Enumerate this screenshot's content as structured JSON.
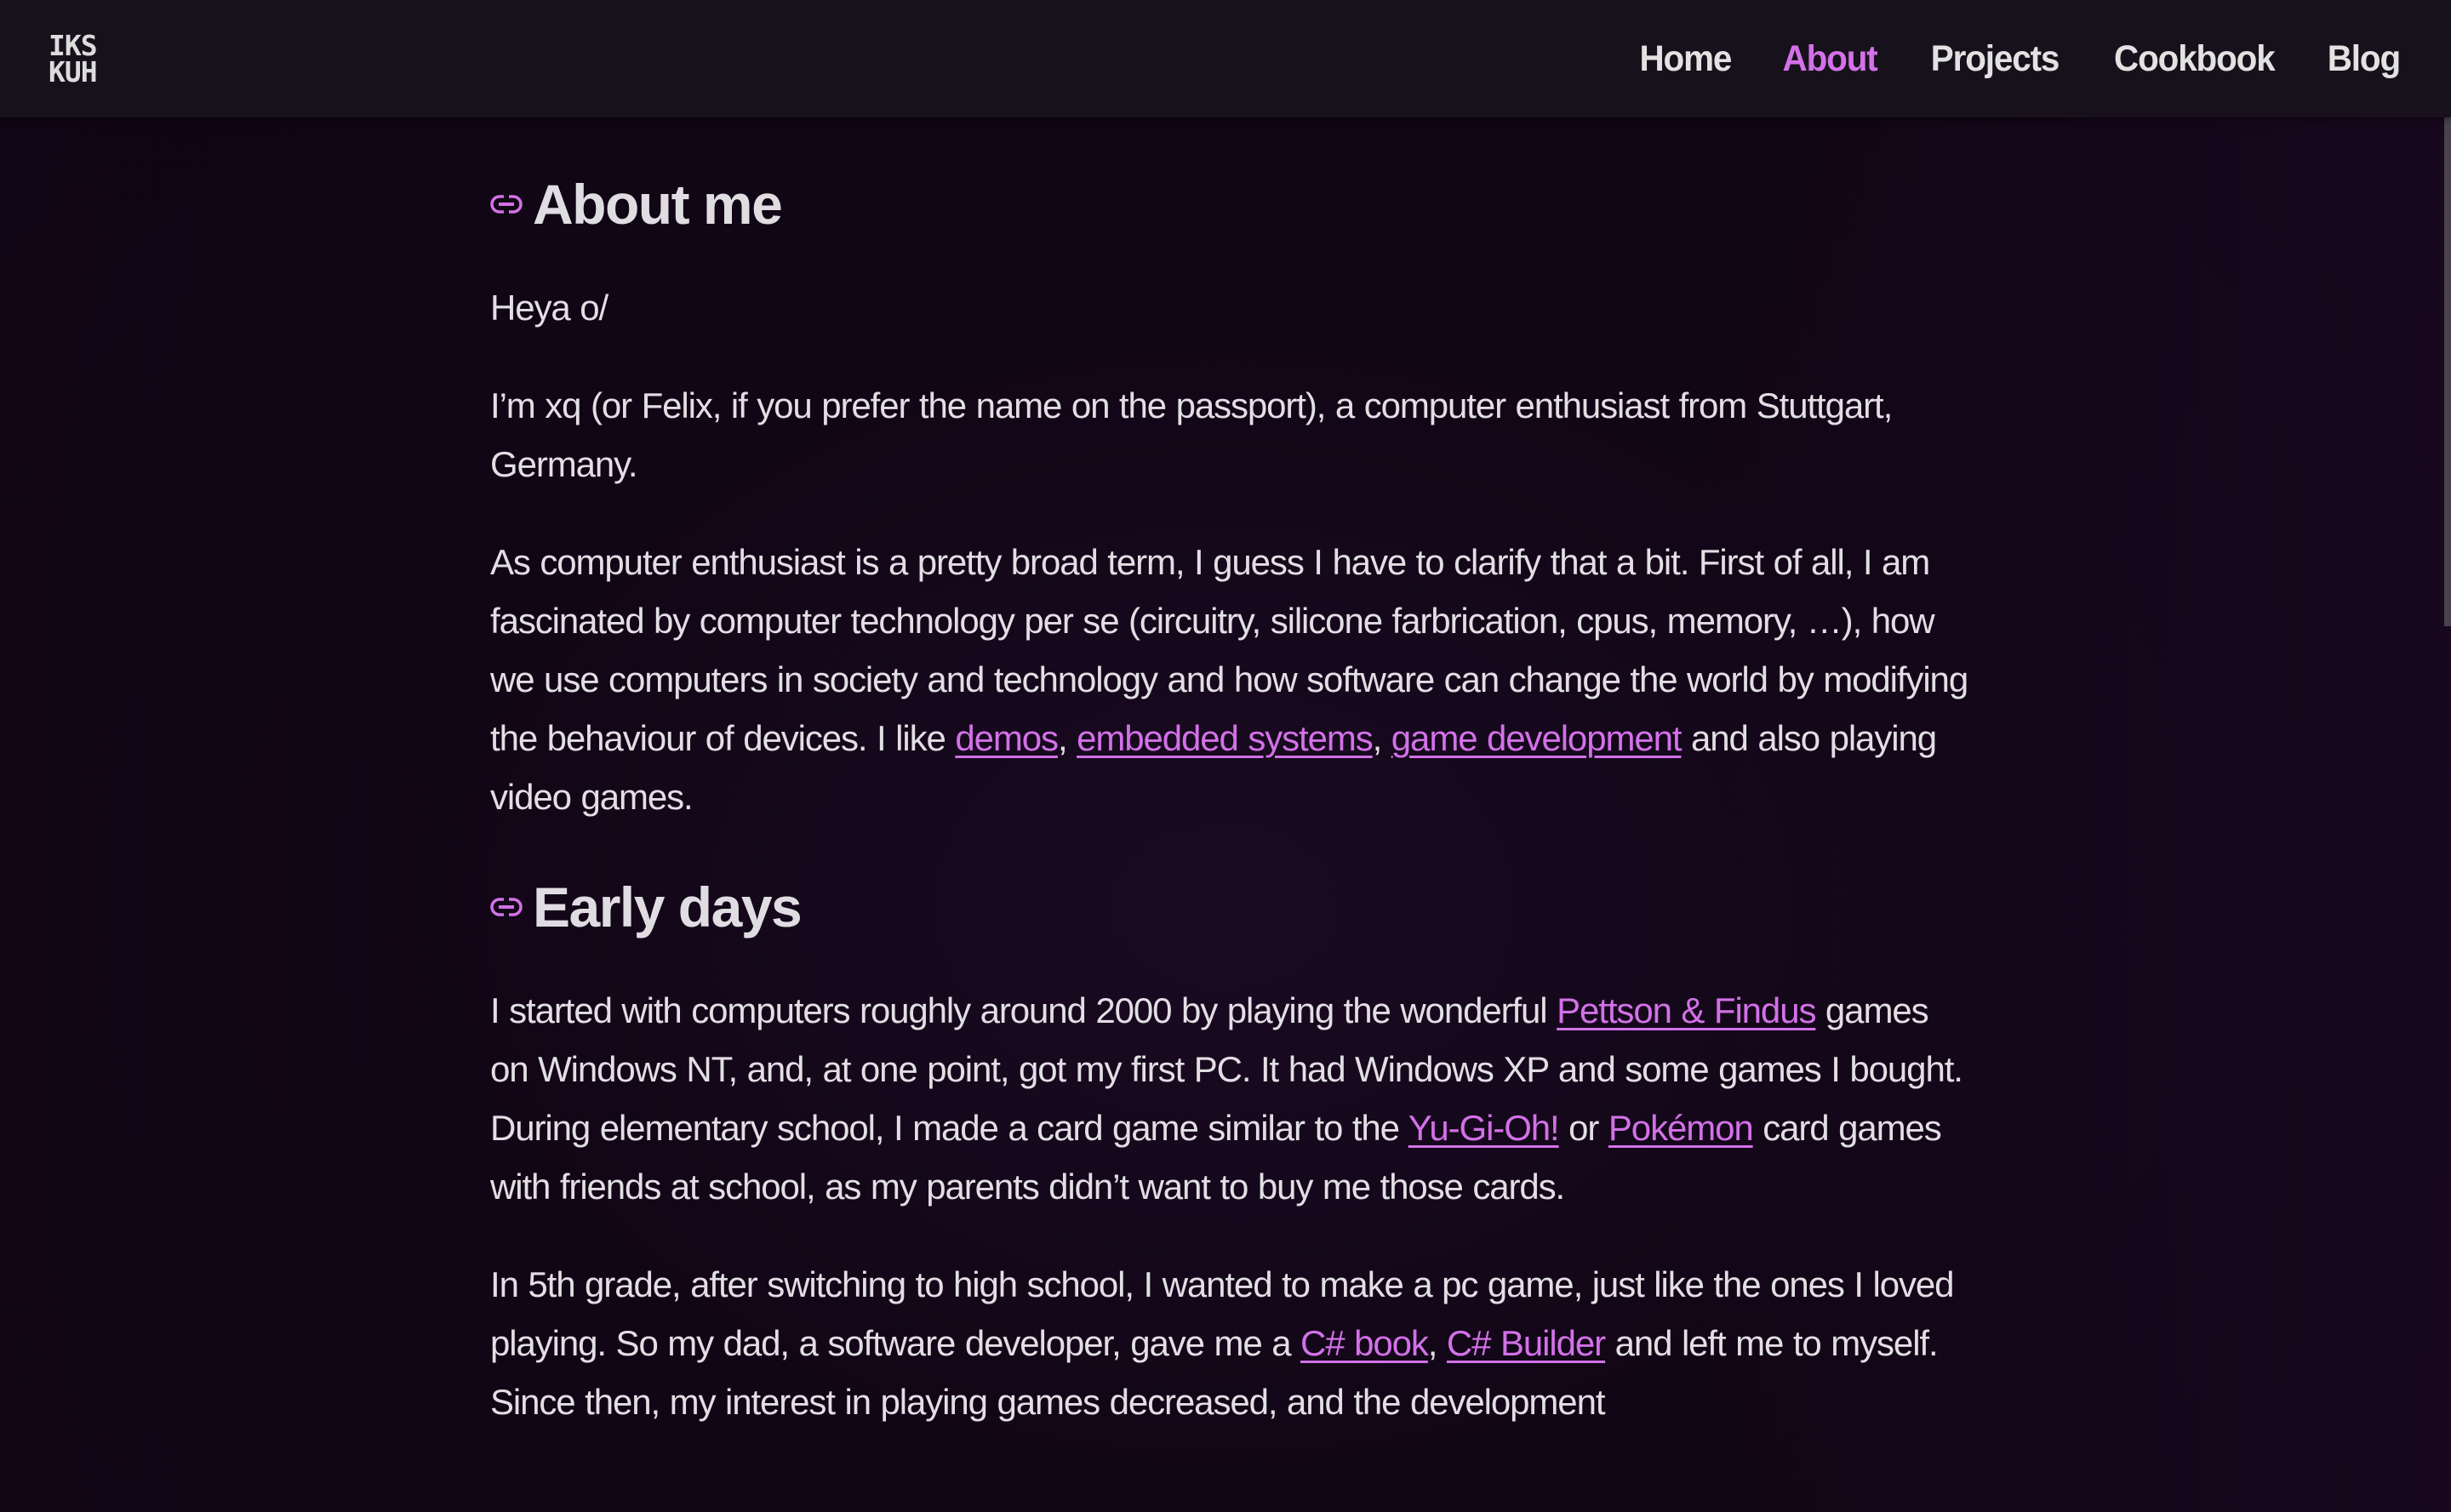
{
  "header": {
    "logo_line1": "IKS",
    "logo_line2": "KUH",
    "nav": [
      {
        "label": "Home",
        "active": false
      },
      {
        "label": "About",
        "active": true
      },
      {
        "label": "Projects",
        "active": false
      },
      {
        "label": "Cookbook",
        "active": false
      },
      {
        "label": "Blog",
        "active": false
      }
    ]
  },
  "colors": {
    "accent": "#d371e8",
    "header_bg": "#17111b",
    "page_bg": "#110616",
    "text": "#e2dfe4"
  },
  "sections": {
    "about": {
      "icon": "link-icon",
      "title": "About me",
      "p1": "Heya o/",
      "p2": "I’m xq (or Felix, if you prefer the name on the passport), a computer enthusiast from Stuttgart, Germany.",
      "p3_a": "As computer enthusiast is a pretty broad term, I guess I have to clarify that a bit. First of all, I am fascinated by computer technology per se (circuitry, silicone farbrication, cpus, memory, …), how we use computers in society and technology and how software can change the world by modifying the behaviour of devices. I like ",
      "p3_link1": "demos",
      "p3_sep1": ", ",
      "p3_link2": "embedded systems",
      "p3_sep2": ", ",
      "p3_link3": "game development",
      "p3_b": " and also playing video games."
    },
    "early_days": {
      "icon": "link-icon",
      "title": "Early days",
      "p1_a": "I started with computers roughly around 2000 by playing the wonderful ",
      "p1_link1": "Pettson & Findus",
      "p1_b": " games on Windows NT, and, at one point, got my first PC. It had Windows XP and some games I bought. During elementary school, I made a card game similar to the ",
      "p1_link2": "Yu-Gi-Oh!",
      "p1_c": " or ",
      "p1_link3": "Pokémon",
      "p1_d": " card games with friends at school, as my parents didn’t want to buy me those cards.",
      "p2_a": "In 5th grade, after switching to high school, I wanted to make a pc game, just like the ones I loved playing. So my dad, a software developer, gave me a ",
      "p2_link1": "C# book",
      "p2_sep": ", ",
      "p2_link2": "C# Builder",
      "p2_b": " and left me to myself. Since then, my interest in playing games decreased, and the development"
    }
  },
  "scroll": {
    "position_fraction": 0.0
  }
}
